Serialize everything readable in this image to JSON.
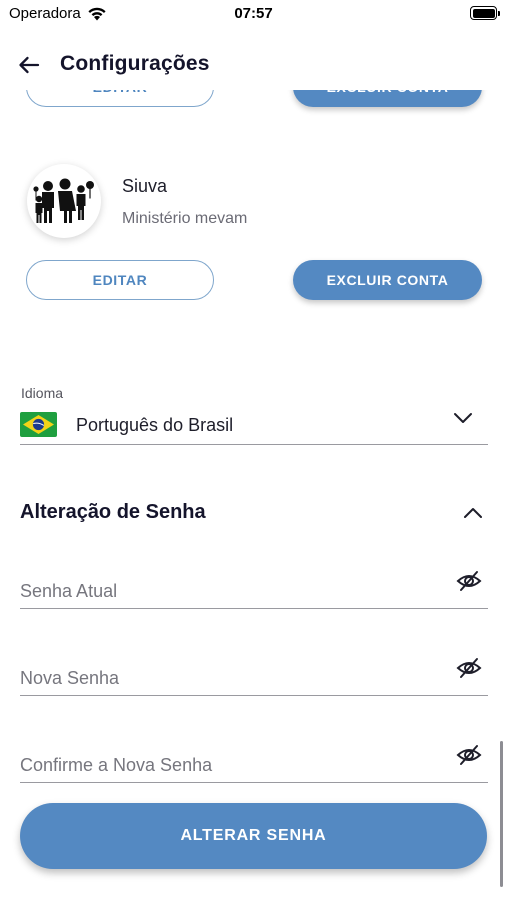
{
  "status_bar": {
    "carrier": "Operadora",
    "time": "07:57"
  },
  "header": {
    "title": "Configurações",
    "back_icon": "arrow-left-icon"
  },
  "accounts": [
    {
      "name": "",
      "subtitle": "",
      "edit_label": "EDITAR",
      "delete_label": "EXCLUIR CONTA"
    },
    {
      "name": "Siuva",
      "subtitle": "Ministério mevam",
      "avatar_icon": "family-icon",
      "edit_label": "EDITAR",
      "delete_label": "EXCLUIR CONTA"
    }
  ],
  "language": {
    "label": "Idioma",
    "value": "Português do Brasil",
    "flag_icon": "brazil-flag-icon"
  },
  "password_section": {
    "title": "Alteração de Senha",
    "fields": [
      {
        "placeholder": "Senha Atual"
      },
      {
        "placeholder": "Nova Senha"
      },
      {
        "placeholder": "Confirme a Nova Senha"
      }
    ],
    "submit_label": "ALTERAR SENHA"
  },
  "colors": {
    "primary": "#5489c2",
    "outline": "#7fa6cc",
    "title": "#14142b",
    "flag_green": "#1f9f3f",
    "flag_yellow": "#f2d318",
    "flag_blue": "#1b3a8c"
  }
}
